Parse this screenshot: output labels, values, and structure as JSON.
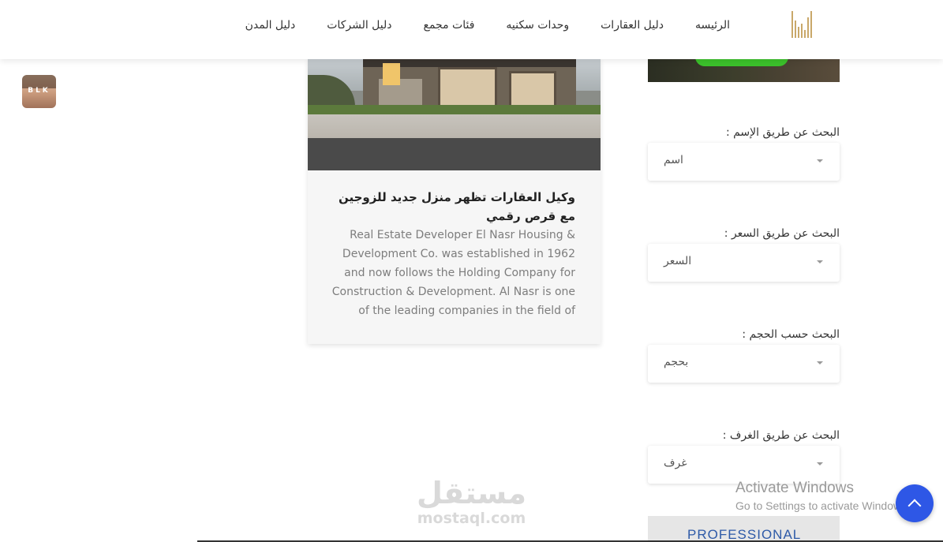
{
  "nav": {
    "items": [
      "الرئيسه",
      "دليل العقارات",
      "وحدات سكنيه",
      "فئات مجمع",
      "دليل الشركات",
      "دليل المدن"
    ]
  },
  "avatar": {
    "text": "BLK"
  },
  "card": {
    "title": "وكيل العقارات تظهر منزل جديد للزوجين مع قرص رقمي",
    "description": "Real Estate Developer El Nasr Housing & Development Co. was established in 1962 and now follows the Holding Company for Construction & Development. Al Nasr is one of the leading companies in the field of"
  },
  "filters": [
    {
      "label": "البحث عن طريق الإسم :",
      "value": "اسم"
    },
    {
      "label": "البحث عن طريق السعر :",
      "value": "السعر"
    },
    {
      "label": "البحث حسب الحجم :",
      "value": "بحجم"
    },
    {
      "label": "البحث عن طريق الغرف :",
      "value": "غرف"
    }
  ],
  "professional": {
    "label": "PROFESSIONAL"
  },
  "activate_windows": {
    "title": "Activate Windows",
    "subtitle": "Go to Settings to activate Windows."
  },
  "watermark": {
    "arabic": "مستقل",
    "latin": "mostaql.com"
  },
  "colors": {
    "accent": "#2e57e6",
    "logo": "#c9a86a",
    "promo_button": "#3bc12b"
  },
  "icons": {
    "scroll_top": "chevron-up-icon",
    "select": "caret-down-icon"
  }
}
